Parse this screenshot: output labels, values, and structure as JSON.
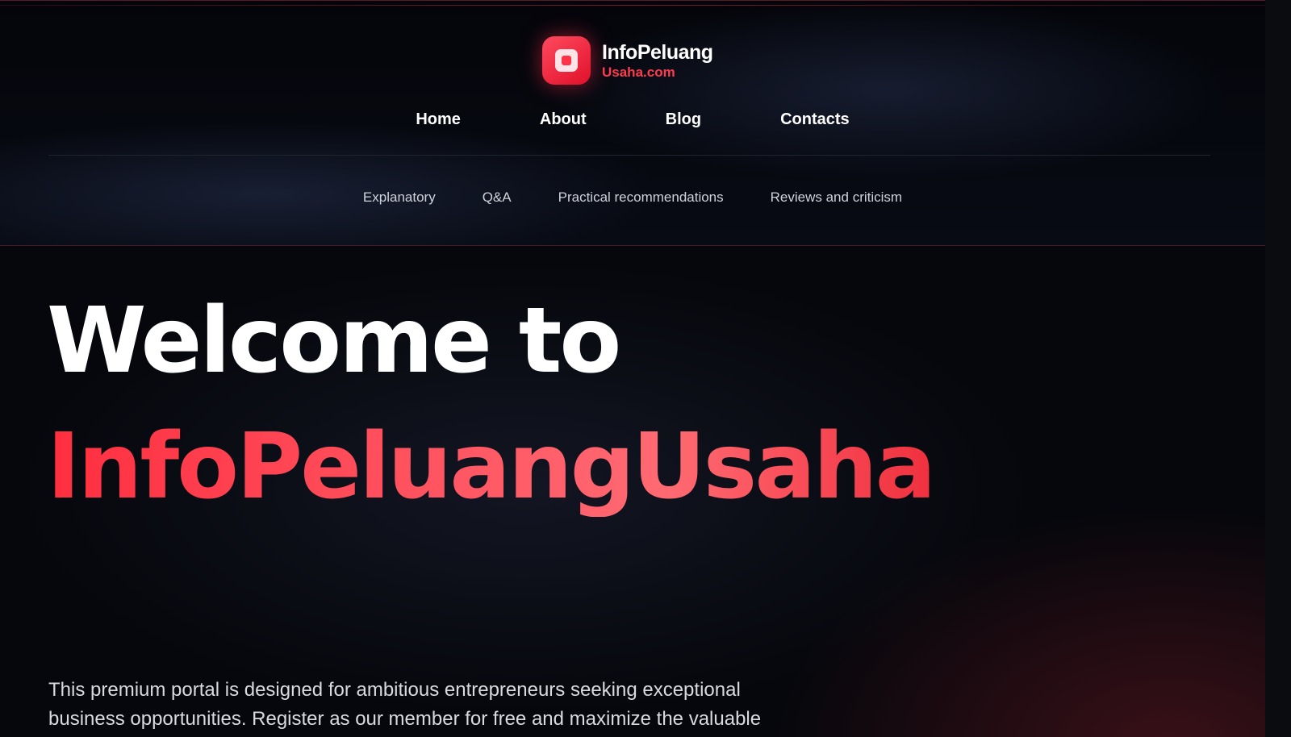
{
  "brand": {
    "title": "InfoPeluang",
    "subtitle": "Usaha.com"
  },
  "nav": {
    "items": [
      "Home",
      "About",
      "Blog",
      "Contacts"
    ]
  },
  "subnav": {
    "items": [
      "Explanatory",
      "Q&A",
      "Practical recommendations",
      "Reviews and criticism"
    ]
  },
  "hero": {
    "heading_line1": "Welcome to",
    "heading_line2": "InfoPeluangUsaha",
    "intro": "This premium portal is designed for ambitious entrepreneurs seeking exceptional business opportunities. Register as our member for free and maximize the valuable"
  },
  "colors": {
    "accent": "#ff3b4f",
    "background": "#05060a"
  }
}
